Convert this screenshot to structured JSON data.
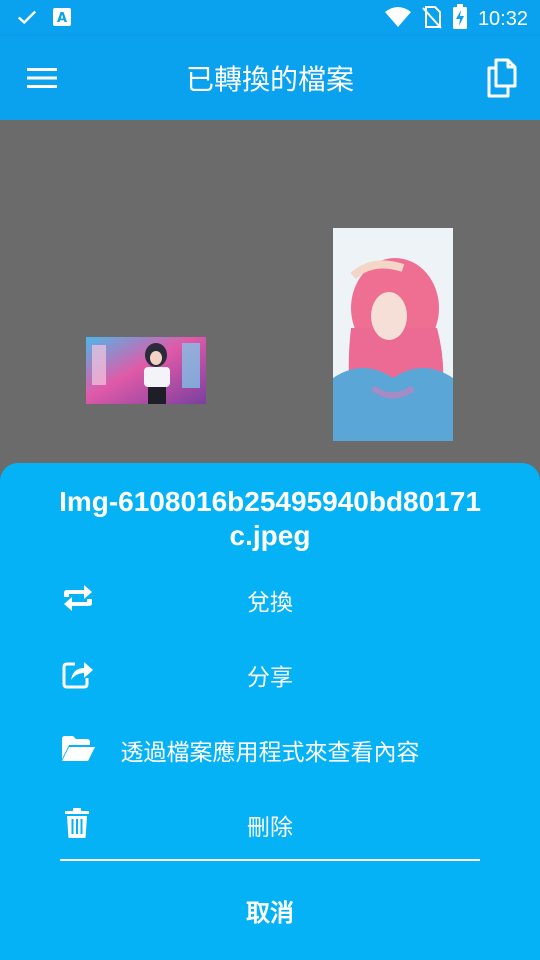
{
  "status_bar": {
    "time": "10:32",
    "icons": [
      "check-icon",
      "app-notification-icon",
      "wifi-icon",
      "no-sim-icon",
      "battery-charging-icon"
    ]
  },
  "app_bar": {
    "title": "已轉換的檔案",
    "menu_icon": "hamburger-menu-icon",
    "action_icon": "copy-files-icon"
  },
  "files": [
    {
      "name": "image-thumbnail-1"
    },
    {
      "name": "image-thumbnail-2"
    }
  ],
  "sheet": {
    "title": "Img-6108016b25495940bd80171c.jpeg",
    "actions": [
      {
        "label": "兌換",
        "icon": "convert-icon"
      },
      {
        "label": "分享",
        "icon": "share-icon"
      },
      {
        "label": "透過檔案應用程式來查看內容",
        "icon": "folder-open-icon"
      },
      {
        "label": "刪除",
        "icon": "trash-icon"
      }
    ],
    "cancel_label": "取消"
  },
  "colors": {
    "primary": "#0aa1ee",
    "sheet": "#05b2f6",
    "background": "#6b6b6b"
  }
}
